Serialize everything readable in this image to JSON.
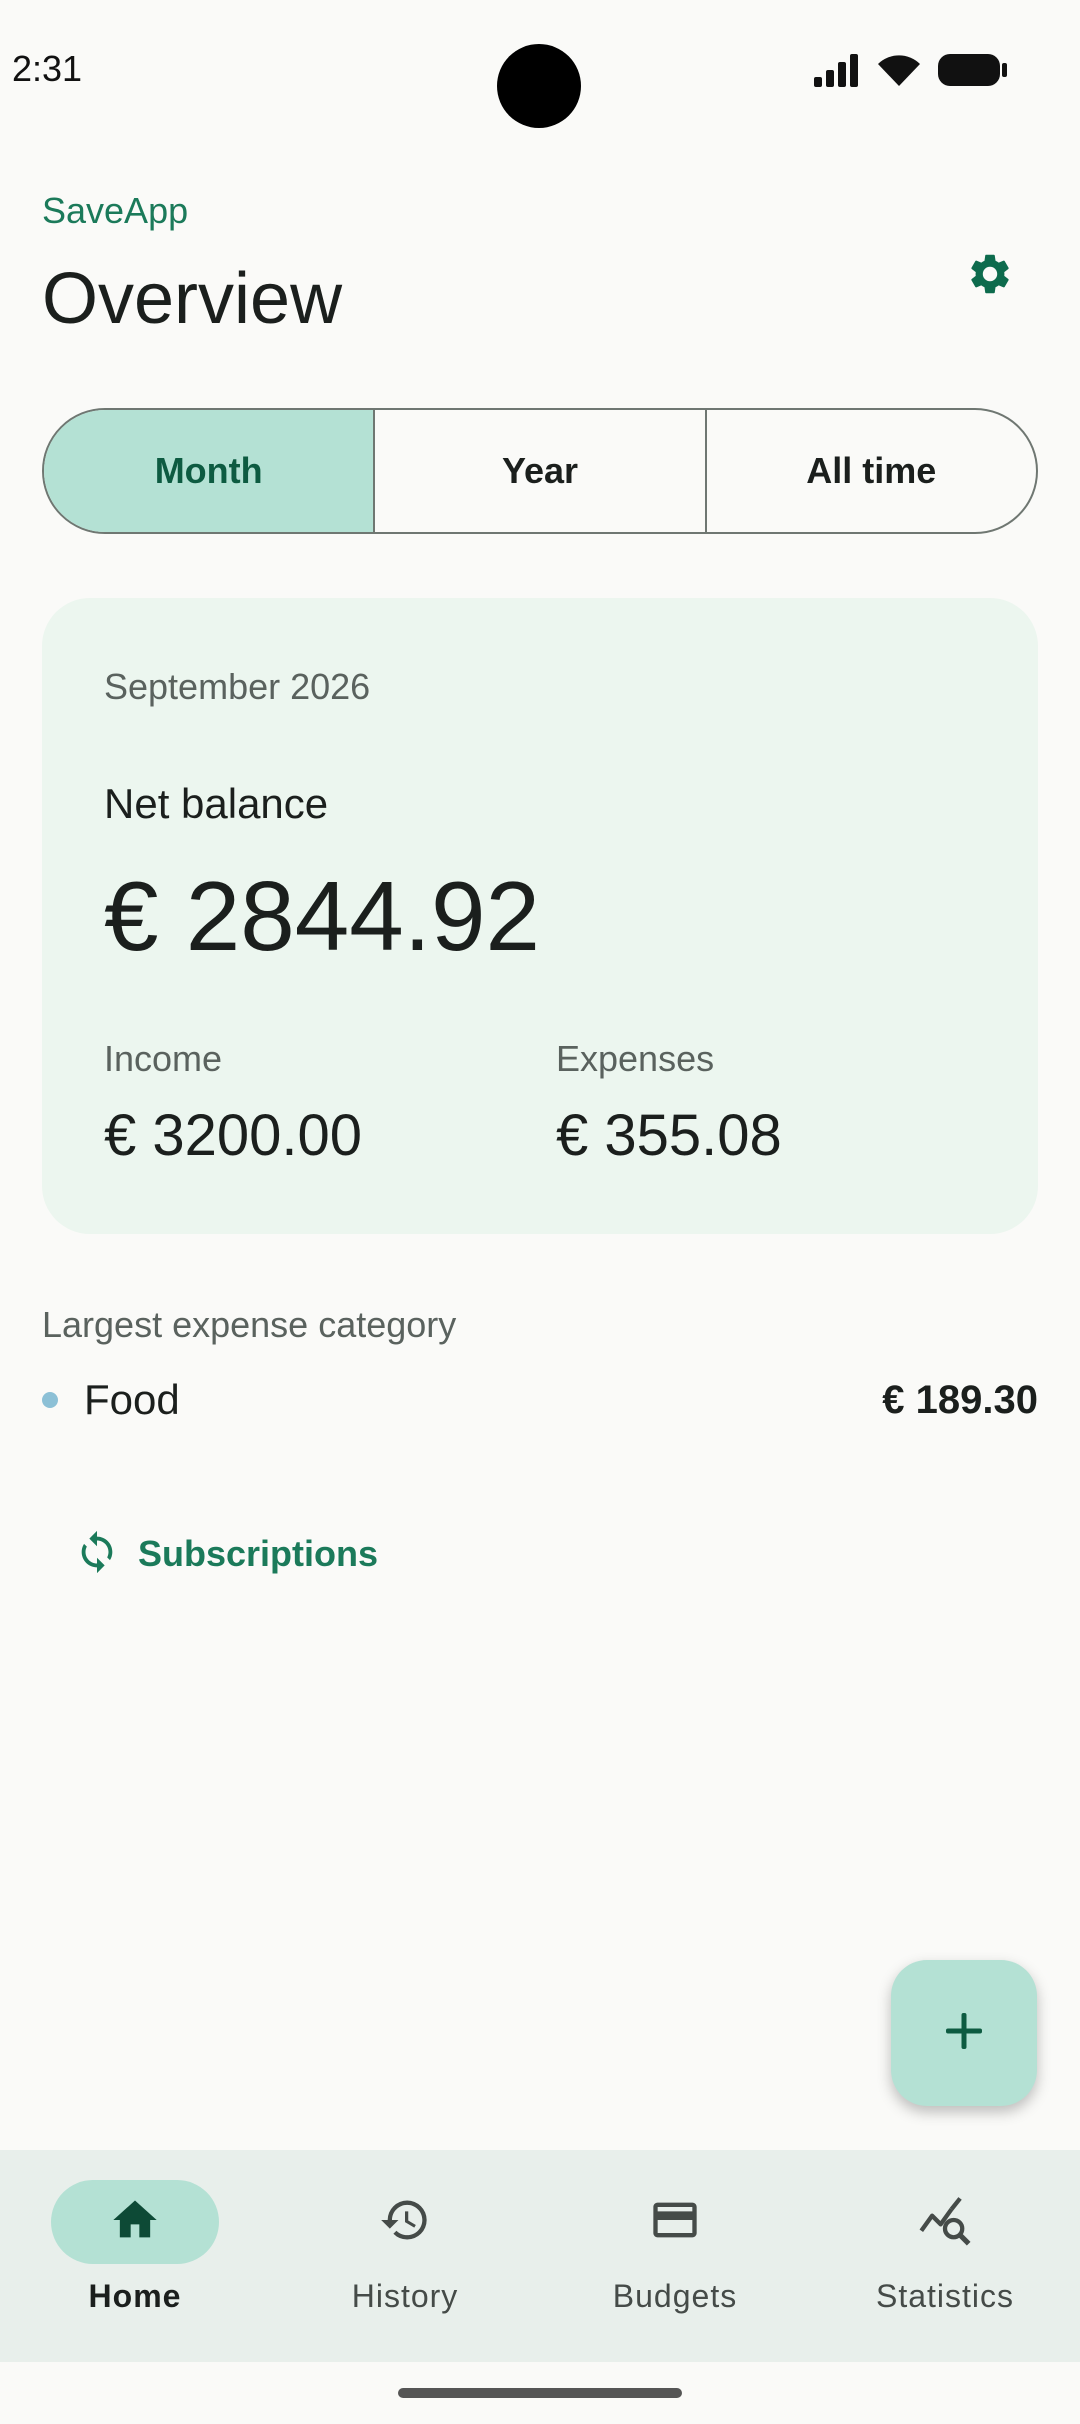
{
  "status_bar": {
    "time": "2:31"
  },
  "header": {
    "app_name": "SaveApp",
    "title": "Overview"
  },
  "period_tabs": [
    {
      "label": "Month",
      "selected": true
    },
    {
      "label": "Year",
      "selected": false
    },
    {
      "label": "All time",
      "selected": false
    }
  ],
  "summary_card": {
    "period": "September 2026",
    "net_label": "Net balance",
    "net_value": "€ 2844.92",
    "income_label": "Income",
    "income_value": "€ 3200.00",
    "expenses_label": "Expenses",
    "expenses_value": "€ 355.08"
  },
  "largest_expense": {
    "label": "Largest expense category",
    "category": "Food",
    "amount": "€ 189.30",
    "dot_color": "#8cc0d6"
  },
  "subscriptions": {
    "label": "Subscriptions",
    "icon": "refresh-icon"
  },
  "fab": {
    "icon": "plus-icon"
  },
  "bottom_nav": [
    {
      "label": "Home",
      "icon": "home-icon",
      "active": true
    },
    {
      "label": "History",
      "icon": "history-icon",
      "active": false
    },
    {
      "label": "Budgets",
      "icon": "card-icon",
      "active": false
    },
    {
      "label": "Statistics",
      "icon": "statistics-icon",
      "active": false
    }
  ],
  "colors": {
    "accent": "#1b7a5a",
    "accent_container": "#b4e1d4",
    "card_background": "#ecf6ef",
    "background": "#fafaf8"
  }
}
